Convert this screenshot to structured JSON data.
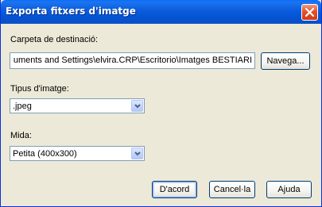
{
  "window": {
    "title": "Exporta fitxers d'imatge"
  },
  "destination": {
    "label": "Carpeta de destinació:",
    "value": "uments and Settings\\elvira.CRP\\Escritorio\\Imatges BESTIARI",
    "browse_label": "Navega..."
  },
  "image_type": {
    "label": "Tipus d'imatge:",
    "selected": ".jpeg"
  },
  "size": {
    "label": "Mida:",
    "selected": "Petita (400x300)"
  },
  "buttons": {
    "ok_label": "D'acord",
    "cancel_label": "Cancel·la",
    "help_label": "Ajuda"
  },
  "icons": {
    "close": "close-icon",
    "dropdown": "chevron-down-icon"
  },
  "colors": {
    "titlebar": "#0453d4",
    "close_button": "#e4502b",
    "dialog_background": "#ece9d8",
    "field_border": "#7f9db9",
    "button_border": "#003c74"
  }
}
